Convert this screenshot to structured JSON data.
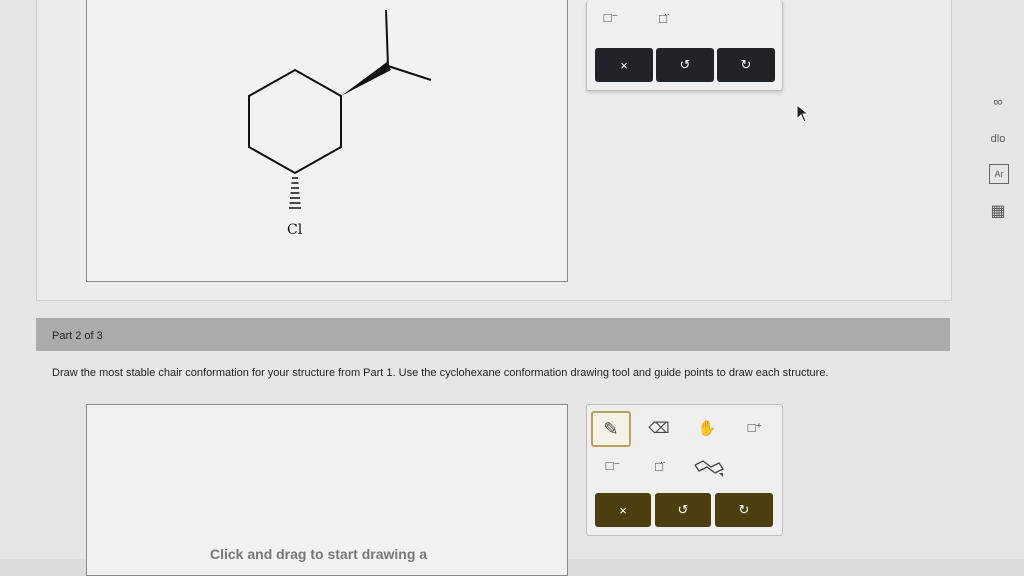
{
  "part1": {
    "structure": {
      "substituent_label": "Cl"
    },
    "toolbar": {
      "tools": [
        {
          "icon": "box-minus-icon",
          "glyph": "□⁻"
        },
        {
          "icon": "box-lone-pair-icon",
          "glyph": "□̈"
        }
      ],
      "buttons": [
        {
          "icon": "clear-icon",
          "label": "×"
        },
        {
          "icon": "undo-icon",
          "label": "↺"
        },
        {
          "icon": "redo-icon",
          "label": "↻"
        }
      ]
    }
  },
  "sidebar": {
    "icons": [
      {
        "name": "infinity-icon",
        "glyph": "∞"
      },
      {
        "name": "chart-icon",
        "glyph": "dlo"
      },
      {
        "name": "periodic-table-icon",
        "glyph": "Ar"
      },
      {
        "name": "calculator-icon",
        "glyph": "▦"
      }
    ]
  },
  "part2": {
    "label": "Part 2 of 3",
    "instructions": "Draw the most stable chair conformation for your structure from Part 1. Use the cyclohexane conformation drawing tool and guide points to draw each structure.",
    "canvas_hint": "Click and drag to start drawing a",
    "toolbar": {
      "tools_row1": [
        {
          "icon": "pencil-icon",
          "glyph": "✎",
          "selected": true
        },
        {
          "icon": "eraser-icon",
          "glyph": "⌫"
        },
        {
          "icon": "hand-icon",
          "glyph": "✋"
        },
        {
          "icon": "box-plus-icon",
          "glyph": "□⁺"
        }
      ],
      "tools_row2": [
        {
          "icon": "box-minus-icon",
          "glyph": "□⁻"
        },
        {
          "icon": "box-lone-pair-icon",
          "glyph": "□̈"
        },
        {
          "icon": "chair-conformation-icon",
          "glyph": "⌇"
        }
      ],
      "buttons": [
        {
          "icon": "clear-icon",
          "label": "×"
        },
        {
          "icon": "undo-icon",
          "label": "↺"
        },
        {
          "icon": "redo-icon",
          "label": "↻"
        }
      ]
    }
  },
  "colors": {
    "button_dark": "#202428",
    "button_olive": "#4b3e0f",
    "part_bar": "#ababab"
  }
}
